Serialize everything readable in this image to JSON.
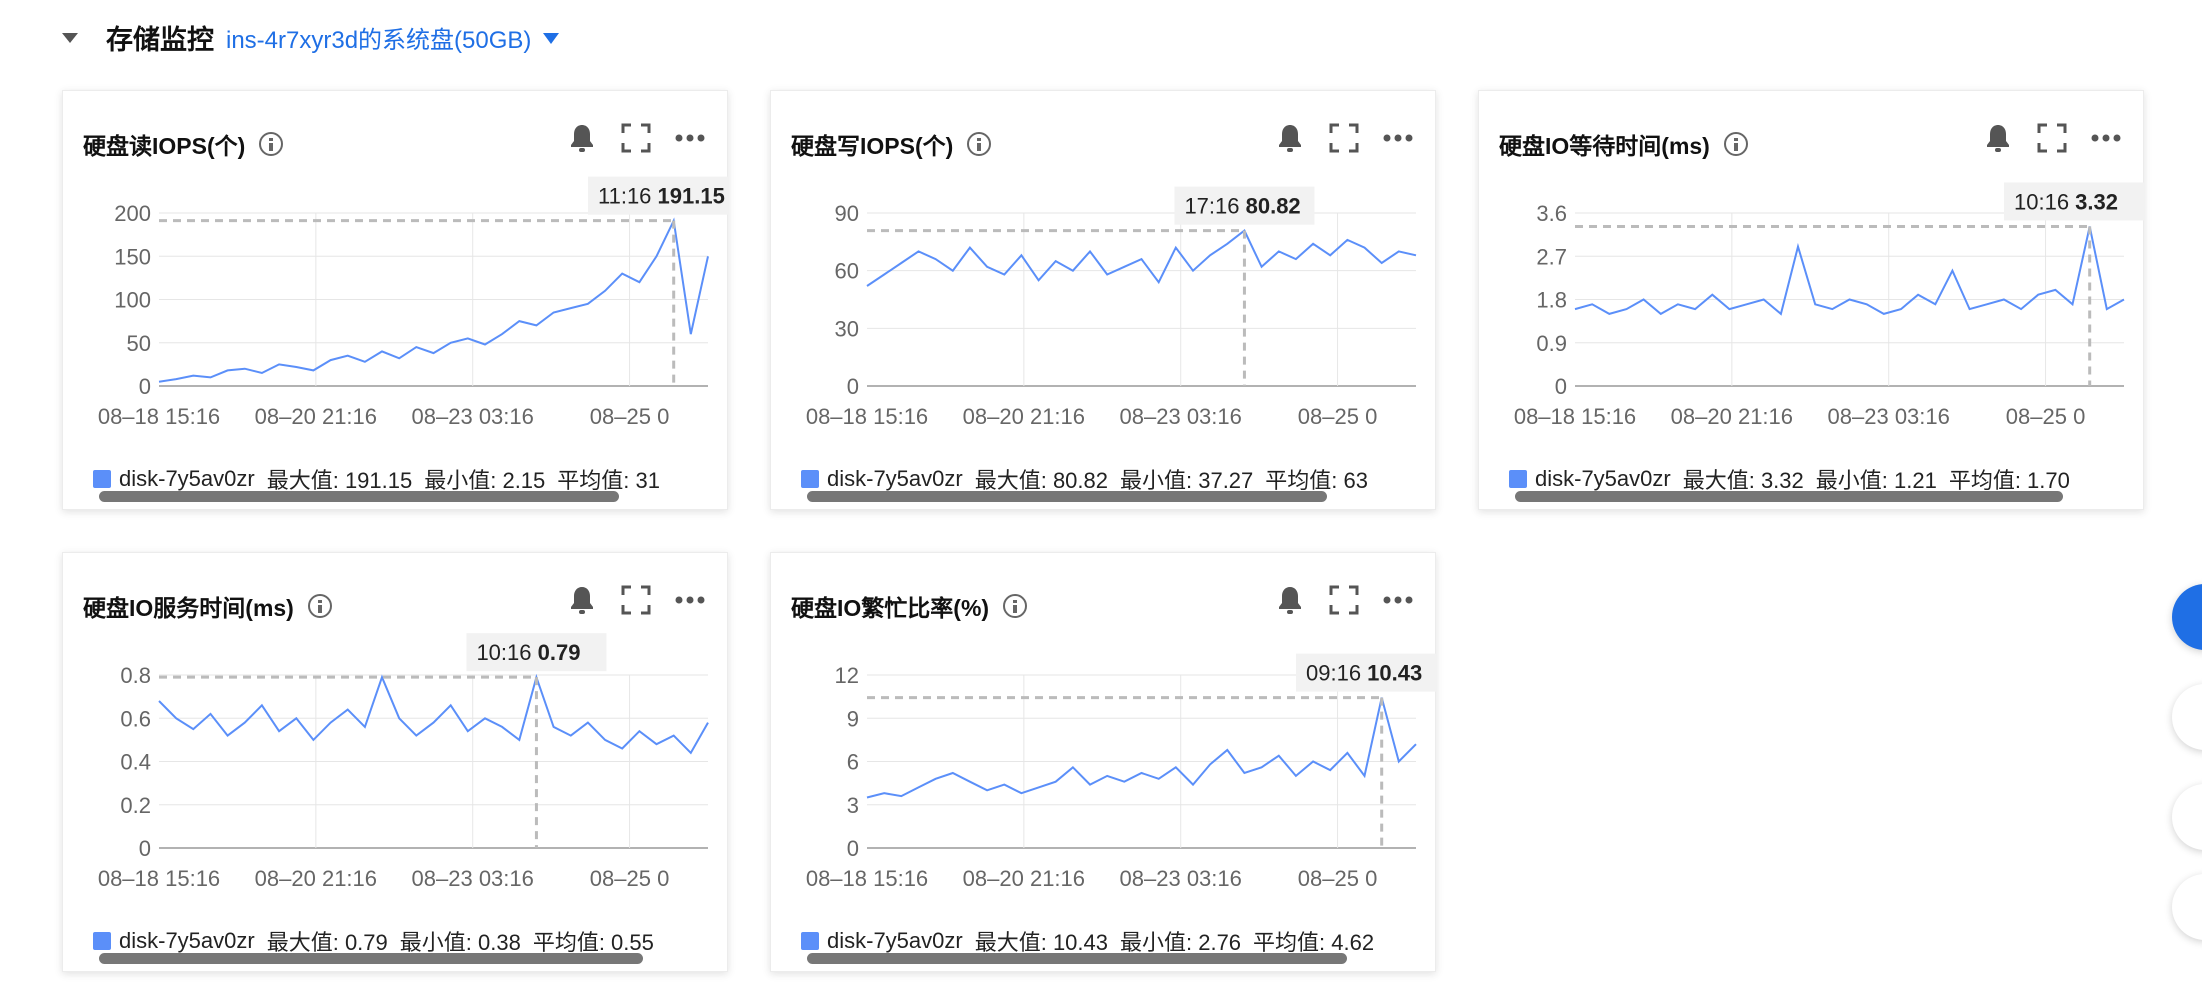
{
  "section": {
    "title": "存储监控",
    "disk_selector": "ins-4r7xyr3d的系统盘(50GB)"
  },
  "colors": {
    "accent": "#1f6fe5",
    "series": "#5b8ff9",
    "grid": "#e6e6e6",
    "marker": "#bbbbbb"
  },
  "icons": [
    "bell-icon",
    "fullscreen-icon",
    "more-icon",
    "info-icon"
  ],
  "chart_data": [
    {
      "type": "line",
      "title": "硬盘读IOPS(个)",
      "xticks": [
        "08–18 15:16",
        "08–20 21:16",
        "08–23 03:16",
        "08–25 0"
      ],
      "yticks": [
        "0",
        "50",
        "100",
        "150",
        "200"
      ],
      "ylim": [
        0,
        200
      ],
      "grid": true,
      "series": [
        {
          "name": "disk-7y5av0zr",
          "values": [
            5,
            8,
            12,
            10,
            18,
            20,
            15,
            25,
            22,
            18,
            30,
            35,
            28,
            40,
            32,
            45,
            38,
            50,
            55,
            48,
            60,
            75,
            70,
            85,
            90,
            95,
            110,
            130,
            120,
            150,
            191.15,
            60,
            150
          ]
        }
      ],
      "tooltip": {
        "time": "11:16",
        "value": "191.15",
        "index": 30
      },
      "legend": {
        "series_label": "disk-7y5av0zr",
        "max": "最大值: 191.15",
        "min": "最小值: 2.15",
        "avg": "平均值: 31"
      }
    },
    {
      "type": "line",
      "title": "硬盘写IOPS(个)",
      "xticks": [
        "08–18 15:16",
        "08–20 21:16",
        "08–23 03:16",
        "08–25 0"
      ],
      "yticks": [
        "0",
        "30",
        "60",
        "90"
      ],
      "ylim": [
        0,
        90
      ],
      "grid": true,
      "series": [
        {
          "name": "disk-7y5av0zr",
          "values": [
            52,
            58,
            64,
            70,
            66,
            60,
            72,
            62,
            58,
            68,
            55,
            65,
            60,
            70,
            58,
            62,
            66,
            54,
            72,
            60,
            68,
            74,
            80.82,
            62,
            70,
            66,
            74,
            68,
            76,
            72,
            64,
            70,
            68
          ]
        }
      ],
      "tooltip": {
        "time": "17:16",
        "value": "80.82",
        "index": 22
      },
      "legend": {
        "series_label": "disk-7y5av0zr",
        "max": "最大值: 80.82",
        "min": "最小值: 37.27",
        "avg": "平均值: 63"
      }
    },
    {
      "type": "line",
      "title": "硬盘IO等待时间(ms)",
      "xticks": [
        "08–18 15:16",
        "08–20 21:16",
        "08–23 03:16",
        "08–25 0"
      ],
      "yticks": [
        "0",
        "0.9",
        "1.8",
        "2.7",
        "3.6"
      ],
      "ylim": [
        0,
        3.6
      ],
      "grid": true,
      "series": [
        {
          "name": "disk-7y5av0zr",
          "values": [
            1.6,
            1.7,
            1.5,
            1.6,
            1.8,
            1.5,
            1.7,
            1.6,
            1.9,
            1.6,
            1.7,
            1.8,
            1.5,
            2.9,
            1.7,
            1.6,
            1.8,
            1.7,
            1.5,
            1.6,
            1.9,
            1.7,
            2.4,
            1.6,
            1.7,
            1.8,
            1.6,
            1.9,
            2.0,
            1.7,
            3.32,
            1.6,
            1.8
          ]
        }
      ],
      "tooltip": {
        "time": "10:16",
        "value": "3.32",
        "index": 30
      },
      "legend": {
        "series_label": "disk-7y5av0zr",
        "max": "最大值: 3.32",
        "min": "最小值: 1.21",
        "avg": "平均值: 1.70"
      }
    },
    {
      "type": "line",
      "title": "硬盘IO服务时间(ms)",
      "xticks": [
        "08–18 15:16",
        "08–20 21:16",
        "08–23 03:16",
        "08–25 0"
      ],
      "yticks": [
        "0",
        "0.2",
        "0.4",
        "0.6",
        "0.8"
      ],
      "ylim": [
        0,
        0.8
      ],
      "grid": true,
      "series": [
        {
          "name": "disk-7y5av0zr",
          "values": [
            0.68,
            0.6,
            0.55,
            0.62,
            0.52,
            0.58,
            0.66,
            0.54,
            0.6,
            0.5,
            0.58,
            0.64,
            0.56,
            0.79,
            0.6,
            0.52,
            0.58,
            0.66,
            0.54,
            0.6,
            0.56,
            0.5,
            0.79,
            0.56,
            0.52,
            0.58,
            0.5,
            0.46,
            0.54,
            0.48,
            0.52,
            0.44,
            0.58
          ]
        }
      ],
      "tooltip": {
        "time": "10:16",
        "value": "0.79",
        "index": 22
      },
      "legend": {
        "series_label": "disk-7y5av0zr",
        "max": "最大值: 0.79",
        "min": "最小值: 0.38",
        "avg": "平均值: 0.55"
      }
    },
    {
      "type": "line",
      "title": "硬盘IO繁忙比率(%)",
      "xticks": [
        "08–18 15:16",
        "08–20 21:16",
        "08–23 03:16",
        "08–25 0"
      ],
      "yticks": [
        "0",
        "3",
        "6",
        "9",
        "12"
      ],
      "ylim": [
        0,
        12
      ],
      "grid": true,
      "series": [
        {
          "name": "disk-7y5av0zr",
          "values": [
            3.5,
            3.8,
            3.6,
            4.2,
            4.8,
            5.2,
            4.6,
            4.0,
            4.4,
            3.8,
            4.2,
            4.6,
            5.6,
            4.4,
            5.0,
            4.6,
            5.2,
            4.8,
            5.6,
            4.4,
            5.8,
            6.8,
            5.2,
            5.6,
            6.4,
            5.0,
            6.0,
            5.4,
            6.6,
            5.0,
            10.43,
            6.0,
            7.2
          ]
        }
      ],
      "tooltip": {
        "time": "09:16",
        "value": "10.43",
        "index": 30
      },
      "legend": {
        "series_label": "disk-7y5av0zr",
        "max": "最大值: 10.43",
        "min": "最小值: 2.76",
        "avg": "平均值: 4.62"
      }
    }
  ]
}
